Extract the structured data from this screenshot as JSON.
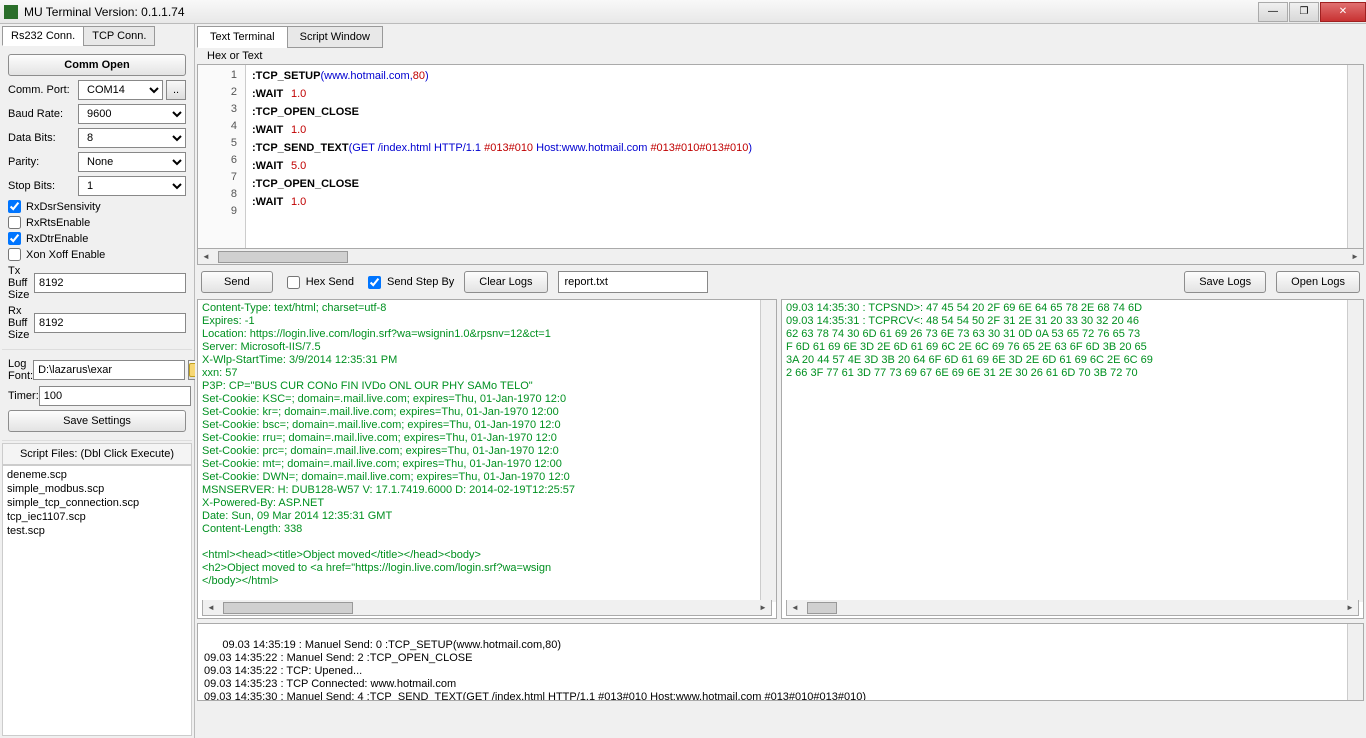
{
  "window": {
    "title": "MU Terminal Version: 0.1.1.74"
  },
  "conn_tabs": {
    "rs232": "Rs232 Conn.",
    "tcp": "TCP Conn."
  },
  "left": {
    "comm_open": "Comm Open",
    "comm_port_label": "Comm. Port:",
    "comm_port_value": "COM14",
    "baud_label": "Baud Rate:",
    "baud_value": "9600",
    "databits_label": "Data Bits:",
    "databits_value": "8",
    "parity_label": "Parity:",
    "parity_value": "None",
    "stopbits_label": "Stop Bits:",
    "stopbits_value": "1",
    "chk_rxdsr": "RxDsrSensivity",
    "chk_rxrts": "RxRtsEnable",
    "chk_rxdtr": "RxDtrEnable",
    "chk_xon": "Xon Xoff Enable",
    "txbuff_label": "Tx Buff Size",
    "txbuff_value": "8192",
    "rxbuff_label": "Rx Buff Size",
    "rxbuff_value": "8192",
    "logfont_label": "Log Font:",
    "logfont_value": "D:\\lazarus\\exar",
    "timer_label": "Timer:",
    "timer_value": "100",
    "save_settings": "Save Settings",
    "script_header": "Script Files: (Dbl Click Execute)",
    "scripts": [
      "deneme.scp",
      "simple_modbus.scp",
      "simple_tcp_connection.scp",
      "tcp_iec1107.scp",
      "test.scp"
    ]
  },
  "main_tabs": {
    "text": "Text Terminal",
    "script": "Script Window"
  },
  "hex_or_text": "Hex or Text",
  "editor": {
    "lines": [
      {
        "n": "1",
        "a": ":",
        "b": "TCP_SETUP",
        "c": "(www.hotmail.com,",
        "d": "80",
        "e": ")"
      },
      {
        "n": "2",
        "a": ":",
        "b": "WAIT",
        "sp": " ",
        "d": "1.0"
      },
      {
        "n": "3",
        "a": ":",
        "b": "TCP_OPEN_CLOSE"
      },
      {
        "n": "4",
        "a": ":",
        "b": "WAIT",
        "sp": " ",
        "d": "1.0"
      },
      {
        "n": "5",
        "a": ":",
        "b": "TCP_SEND_TEXT",
        "c": "(GET /index.html HTTP/1.1 ",
        "r1": "#013#010",
        "c2": " Host:www.hotmail.com ",
        "r2": "#013#010#013#010",
        "e": ")"
      },
      {
        "n": "6",
        "a": ":",
        "b": "WAIT",
        "sp": " ",
        "d": "5.0"
      },
      {
        "n": "7",
        "a": ":",
        "b": "TCP_OPEN_CLOSE"
      },
      {
        "n": "8",
        "a": ":",
        "b": "WAIT",
        "sp": " ",
        "d": "1.0"
      },
      {
        "n": "9"
      }
    ]
  },
  "actions": {
    "send": "Send",
    "hex_send": "Hex Send",
    "send_step": "Send Step By",
    "clear_logs": "Clear Logs",
    "filename": "report.txt",
    "save_logs": "Save Logs",
    "open_logs": "Open Logs"
  },
  "log_left": "Content-Type: text/html; charset=utf-8\nExpires: -1\nLocation: https://login.live.com/login.srf?wa=wsignin1.0&rpsnv=12&ct=1\nServer: Microsoft-IIS/7.5\nX-Wlp-StartTime: 3/9/2014 12:35:31 PM\nxxn: 57\nP3P: CP=\"BUS CUR CONo FIN IVDo ONL OUR PHY SAMo TELO\"\nSet-Cookie: KSC=; domain=.mail.live.com; expires=Thu, 01-Jan-1970 12:0\nSet-Cookie: kr=; domain=.mail.live.com; expires=Thu, 01-Jan-1970 12:00\nSet-Cookie: bsc=; domain=.mail.live.com; expires=Thu, 01-Jan-1970 12:0\nSet-Cookie: rru=; domain=.mail.live.com; expires=Thu, 01-Jan-1970 12:0\nSet-Cookie: prc=; domain=.mail.live.com; expires=Thu, 01-Jan-1970 12:0\nSet-Cookie: mt=; domain=.mail.live.com; expires=Thu, 01-Jan-1970 12:00\nSet-Cookie: DWN=; domain=.mail.live.com; expires=Thu, 01-Jan-1970 12:0\nMSNSERVER: H: DUB128-W57 V: 17.1.7419.6000 D: 2014-02-19T12:25:57\nX-Powered-By: ASP.NET\nDate: Sun, 09 Mar 2014 12:35:31 GMT\nContent-Length: 338\n\n<html><head><title>Object moved</title></head><body>\n<h2>Object moved to <a href=\"https://login.live.com/login.srf?wa=wsign\n</body></html>",
  "log_right": "09.03 14:35:30 : TCPSND>: 47 45 54 20 2F 69 6E 64 65 78 2E 68 74 6D\n09.03 14:35:31 : TCPRCV<: 48 54 54 50 2F 31 2E 31 20 33 30 32 20 46\n62 63 78 74 30 6D 61 69 26 73 6E 73 63 30 31 0D 0A 53 65 72 76 65 73\nF 6D 61 69 6E 3D 2E 6D 61 69 6C 2E 6C 69 76 65 2E 63 6F 6D 3B 20 65\n3A 20 44 57 4E 3D 3B 20 64 6F 6D 61 69 6E 3D 2E 6D 61 69 6C 2E 6C 69\n2 66 3F 77 61 3D 77 73 69 67 6E 69 6E 31 2E 30 26 61 6D 70 3B 72 70",
  "bottom_log": "09.03 14:35:19 : Manuel Send: 0 :TCP_SETUP(www.hotmail.com,80)\n09.03 14:35:22 : Manuel Send: 2 :TCP_OPEN_CLOSE\n09.03 14:35:22 : TCP: Upened...\n09.03 14:35:23 : TCP Connected: www.hotmail.com\n09.03 14:35:30 : Manuel Send: 4 :TCP_SEND_TEXT(GET /index.html HTTP/1.1 #013#010 Host:www.hotmail.com #013#010#013#010)"
}
